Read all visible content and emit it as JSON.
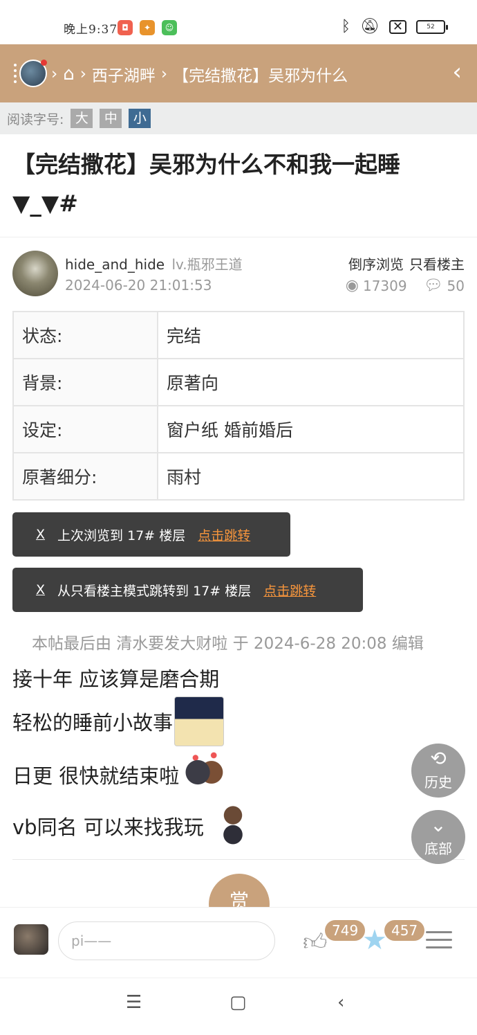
{
  "status_bar": {
    "time": "晚上9:37",
    "battery": "52"
  },
  "nav": {
    "sep1": "›",
    "home_icon": "⌂",
    "sep2": "›",
    "forum": "西子湖畔",
    "sep3": "›",
    "thread_short": "【完结撒花】吴邪为什么",
    "back_icon": "‹"
  },
  "font_size": {
    "label": "阅读字号:",
    "large": "大",
    "medium": "中",
    "small": "小"
  },
  "post": {
    "title": "【完结撒花】吴邪为什么不和我一起睡▼_▼#",
    "author": "hide_and_hide",
    "level": "lv.瓶邪王道",
    "date": "2024-06-20 21:01:53",
    "reverse_label": "倒序浏览",
    "op_only_label": "只看楼主",
    "views": "17309",
    "replies": "50"
  },
  "info_table": [
    {
      "key": "状态:",
      "value": "完结"
    },
    {
      "key": "背景:",
      "value": "原著向"
    },
    {
      "key": "设定:",
      "value": "窗户纸 婚前婚后"
    },
    {
      "key": "原著细分:",
      "value": "雨村"
    }
  ],
  "toasts": [
    {
      "close": "X",
      "text": "上次浏览到 17# 楼层",
      "link": "点击跳转"
    },
    {
      "close": "X",
      "text": "从只看楼主模式跳转到 17# 楼层",
      "link": "点击跳转"
    }
  ],
  "edit_note": "本帖最后由 清水要发大财啦 于 2024-6-28 20:08 编辑",
  "content_lines": [
    "接十年 应该算是磨合期",
    "轻松的睡前小故事",
    "日更 很快就结束啦",
    "vb同名 可以来找我玩"
  ],
  "reward_label": "赏",
  "float_buttons": {
    "history": "历史",
    "bottom": "底部"
  },
  "bottom_bar": {
    "reply_placeholder": "pi——",
    "likes": "749",
    "favorites": "457"
  }
}
